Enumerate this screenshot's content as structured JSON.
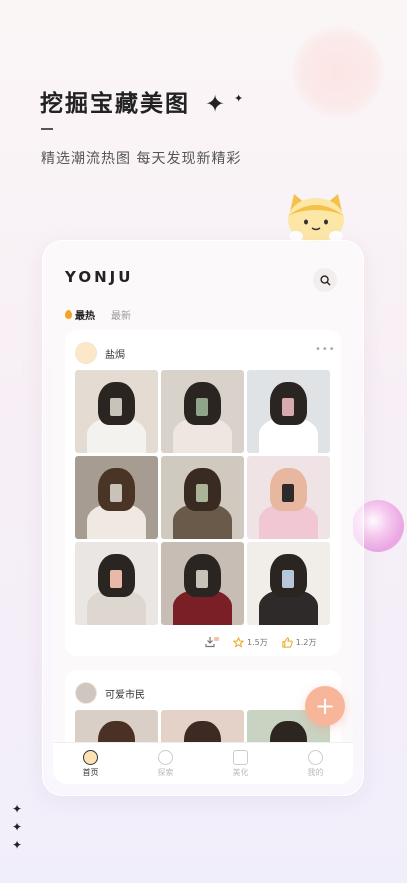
{
  "promo": {
    "headline": "挖掘宝藏美图",
    "subline": "精选潮流热图 每天发现新精彩"
  },
  "app": {
    "logo": "YONJU"
  },
  "tabs": [
    {
      "label": "最热",
      "active": true
    },
    {
      "label": "最新",
      "active": false
    }
  ],
  "feed": [
    {
      "author": "盐焗",
      "stats": {
        "favorites": "1.5万",
        "likes": "1.2万"
      }
    },
    {
      "author": "可爱市民"
    }
  ],
  "bottom_nav": [
    {
      "label": "首页",
      "icon": "home-icon",
      "active": true
    },
    {
      "label": "探索",
      "icon": "explore-icon",
      "active": false
    },
    {
      "label": "美化",
      "icon": "beautify-icon",
      "active": false
    },
    {
      "label": "我的",
      "icon": "profile-icon",
      "active": false
    }
  ],
  "colors": {
    "accent": "#f5a22a",
    "fab": "#f7b69a"
  }
}
